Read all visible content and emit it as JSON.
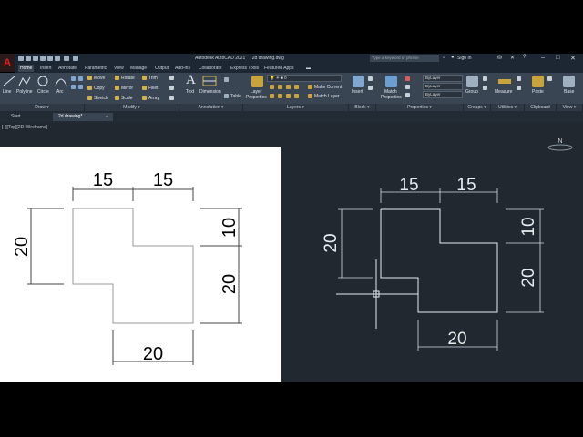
{
  "app": {
    "title": "Autodesk AutoCAD 2021",
    "drawing_name": "2d drawing.dwg",
    "search_placeholder": "Type a keyword or phrase",
    "signin": "Sign In",
    "logo": "A"
  },
  "ribbon_tabs": [
    "Home",
    "Insert",
    "Annotate",
    "Parametric",
    "View",
    "Manage",
    "Output",
    "Add-ins",
    "Collaborate",
    "Express Tools",
    "Featured Apps"
  ],
  "ribbon": {
    "draw": {
      "line": "Line",
      "polyline": "Polyline",
      "circle": "Circle",
      "arc": "Arc",
      "footer": "Draw ▾"
    },
    "modify": {
      "move": "Move",
      "rotate": "Rotate",
      "trim": "Trim",
      "copy": "Copy",
      "mirror": "Mirror",
      "fillet": "Fillet",
      "stretch": "Stretch",
      "scale": "Scale",
      "array": "Array",
      "footer": "Modify ▾"
    },
    "annotation": {
      "text": "Text",
      "dimension": "Dimension",
      "table": "Table",
      "footer": "Annotation ▾"
    },
    "layers": {
      "layer_properties": "Layer Properties",
      "make_current": "Make Current",
      "match_layer": "Match Layer",
      "footer": "Layers ▾"
    },
    "block": {
      "insert": "Insert",
      "footer": "Block ▾"
    },
    "properties": {
      "match": "Match Properties",
      "bylayer1": "ByLayer",
      "bylayer2": "ByLayer",
      "bylayer3": "ByLayer",
      "footer": "Properties ▾"
    },
    "groups": {
      "group": "Group",
      "footer": "Groups ▾"
    },
    "utilities": {
      "measure": "Measure",
      "footer": "Utilities ▾"
    },
    "clipboard": {
      "paste": "Paste",
      "footer": "Clipboard"
    },
    "view": {
      "base": "Base",
      "footer": "View ▾"
    }
  },
  "doc_tabs": {
    "start": "Start",
    "drawing": "2d drawing*",
    "add": "+"
  },
  "viewport": {
    "label": "[–][Top][2D Wireframe]",
    "viewcube_label": "N"
  },
  "left_drawing": {
    "top_left": "15",
    "top_right": "15",
    "left": "20",
    "right_top": "10",
    "right_bottom": "20",
    "bottom": "20"
  },
  "right_drawing": {
    "top_left": "15",
    "top_right": "15",
    "left": "20",
    "right_top": "10",
    "right_bottom": "20",
    "bottom": "20"
  },
  "colors": {
    "canvas": "#212830",
    "ribbon": "#3a4554",
    "title": "#1d2733",
    "drawing_line": "#e8ecef",
    "accent_red": "#e02020"
  }
}
